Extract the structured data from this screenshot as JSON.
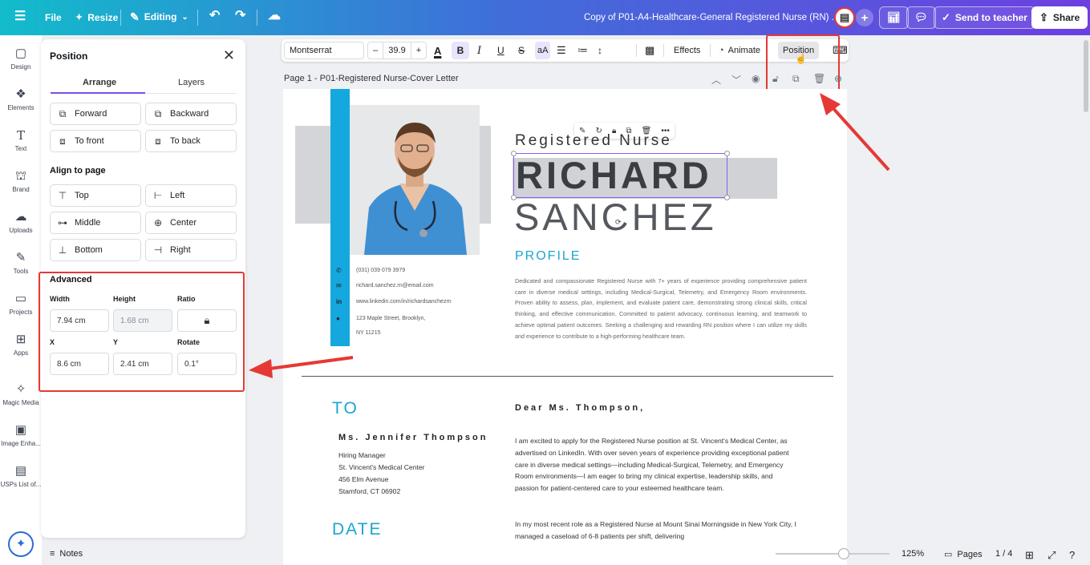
{
  "topbar": {
    "file_label": "File",
    "resize_label": "Resize",
    "editing_label": "Editing",
    "doc_title": "Copy of P01-A4-Healthcare-General Registered Nurse (RN) ...",
    "send_label": "Send to teacher",
    "share_label": "Share"
  },
  "rail": {
    "items": [
      {
        "label": "Design",
        "icon": "design-icon"
      },
      {
        "label": "Elements",
        "icon": "elements-icon"
      },
      {
        "label": "Text",
        "icon": "text-icon"
      },
      {
        "label": "Brand",
        "icon": "brand-icon"
      },
      {
        "label": "Uploads",
        "icon": "uploads-icon"
      },
      {
        "label": "Tools",
        "icon": "tools-icon"
      },
      {
        "label": "Projects",
        "icon": "projects-icon"
      },
      {
        "label": "Apps",
        "icon": "apps-icon"
      },
      {
        "label": "Magic Media",
        "icon": "magic-media-icon"
      },
      {
        "label": "Image Enha...",
        "icon": "image-enhancer-icon"
      },
      {
        "label": "USPs List of...",
        "icon": "usps-list-icon"
      }
    ]
  },
  "panel": {
    "title": "Position",
    "tabs": [
      "Arrange",
      "Layers"
    ],
    "arrange": {
      "forward": "Forward",
      "backward": "Backward",
      "to_front": "To front",
      "to_back": "To back"
    },
    "align_heading": "Align to page",
    "align": {
      "top": "Top",
      "left": "Left",
      "middle": "Middle",
      "center": "Center",
      "bottom": "Bottom",
      "right": "Right"
    },
    "advanced_heading": "Advanced",
    "labels": {
      "width": "Width",
      "height": "Height",
      "ratio": "Ratio",
      "x": "X",
      "y": "Y",
      "rotate": "Rotate"
    },
    "values": {
      "width": "7.94 cm",
      "height": "1.68 cm",
      "x": "8.6 cm",
      "y": "2.41 cm",
      "rotate": "0.1°"
    }
  },
  "toolbar": {
    "font": "Montserrat",
    "size_minus": "–",
    "size": "39.9",
    "size_plus": "+",
    "bold": "B",
    "italic": "I",
    "underline": "U",
    "strike": "S",
    "case": "aA",
    "effects": "Effects",
    "animate": "Animate",
    "position": "Position"
  },
  "page": {
    "label": "Page 1 - P01-Registered Nurse-Cover Letter"
  },
  "doc": {
    "role": "Registered Nurse",
    "first_name": "RICHARD",
    "last_name": "SANCHEZ",
    "phone": "(031) 039 079 3979",
    "email": "richard.sanchez.rn@email.com",
    "linkedin": "www.linkedin.com/in/richardsanchezrn",
    "address_line1": "123 Maple Street, Brooklyn,",
    "address_line2": "NY 11215",
    "profile_heading": "PROFILE",
    "profile_text": "Dedicated and compassionate Registered Nurse with 7+ years of experience providing comprehensive patient care in diverse medical settings, including Medical-Surgical, Telemetry, and Emergency Room environments. Proven ability to assess, plan, implement, and evaluate patient care, demonstrating strong clinical skills, critical thinking, and effective communication. Committed to patient advocacy, continuous learning, and teamwork to achieve optimal patient outcomes. Seeking a challenging and rewarding RN position where I can utilize my skills and experience to contribute to a high-performing healthcare team.",
    "to_heading": "TO",
    "recipient_name": "Ms. Jennifer Thompson",
    "recipient_title": "Hiring Manager",
    "recipient_org": "St. Vincent's Medical Center",
    "recipient_street": "456 Elm Avenue",
    "recipient_city": "Stamford, CT 06902",
    "date_heading": "DATE",
    "salutation": "Dear Ms. Thompson,",
    "para1": "I am excited to apply for the Registered Nurse position at St. Vincent's Medical Center, as advertised on LinkedIn. With over seven years of experience providing exceptional patient care in diverse medical settings—including Medical-Surgical, Telemetry, and Emergency Room environments—I am eager to bring my clinical expertise, leadership skills, and passion for patient-centered care to your esteemed healthcare team.",
    "para2": "In my most recent role as a Registered Nurse at Mount Sinai Morningside in New York City, I managed a caseload of 6-8 patients per shift, delivering"
  },
  "bottombar": {
    "notes": "Notes",
    "zoom_fraction": 0.6,
    "zoom": "125%",
    "pages": "Pages",
    "page_count": "1 / 4"
  },
  "colors": {
    "accent": "#7b4ee6",
    "teal": "#1aa6d0",
    "annotation_red": "#e53935"
  }
}
